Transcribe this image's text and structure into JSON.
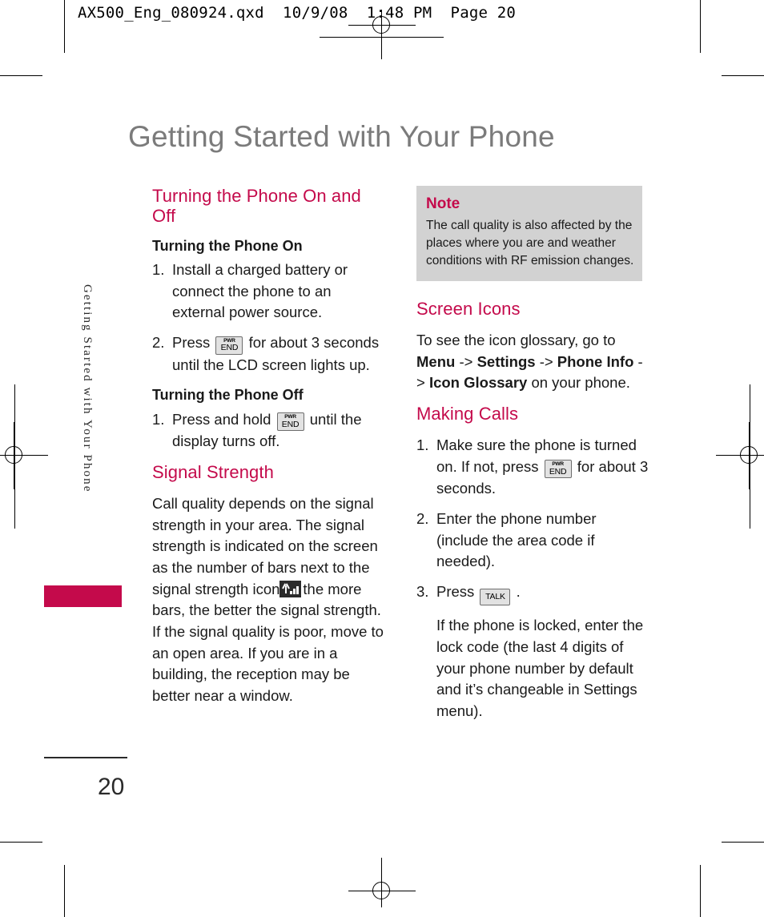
{
  "printer_slug": "AX500_Eng_080924.qxd  10/9/08  1:48 PM  Page 20",
  "page_title": "Getting Started with Your Phone",
  "side_tab": {
    "label": "Getting Started with Your Phone"
  },
  "page_number": "20",
  "left_column": {
    "section_heading": "Turning the Phone On and Off",
    "subheading_on": "Turning the Phone On",
    "on_steps": [
      {
        "num": "1.",
        "text": "Install a charged battery or connect the phone to an external power source."
      },
      {
        "num": "2.",
        "text_before": "Press",
        "key": "PWR END",
        "text_after": "for about 3 seconds until the LCD screen lights up."
      }
    ],
    "subheading_off": "Turning the Phone Off",
    "off_steps": [
      {
        "num": "1.",
        "text_before": "Press and hold",
        "key": "PWR END",
        "text_after": "until the display turns off."
      }
    ],
    "signal_heading": "Signal Strength",
    "signal_text_before": "Call quality depends on the signal strength in your area. The signal strength is indicated on the screen as the number of bars next to the signal strength icon",
    "signal_icon": "signal-strength-icon",
    "signal_text_after": "the more bars, the better the signal strength. If the signal quality is poor, move to an open area. If you are in a building, the reception may be better near a window."
  },
  "right_column": {
    "note": {
      "title": "Note",
      "text": "The call quality is also affected by the places where you are and weather conditions with RF emission changes."
    },
    "screen_icons_heading": "Screen Icons",
    "screen_icons_text_intro": "To see the icon glossary, go to",
    "screen_icons_path": [
      "Menu",
      "Settings",
      "Phone Info",
      "Icon Glossary"
    ],
    "screen_icons_arrow": "->",
    "screen_icons_text_outro": "on your phone.",
    "making_calls_heading": "Making Calls",
    "call_steps": [
      {
        "num": "1.",
        "text_before": "Make sure the phone is turned on. If not, press",
        "key": "PWR END",
        "text_after": "for about 3 seconds."
      },
      {
        "num": "2.",
        "text": "Enter the phone number (include the area code if needed)."
      },
      {
        "num": "3.",
        "text_before": "Press",
        "key": "TALK",
        "text_after": "."
      }
    ],
    "locked_note": "If the phone is locked, enter the lock code (the last 4 digits of your phone number by default and it’s changeable in Settings menu)."
  },
  "keys": {
    "pwr_line1": "PWR",
    "pwr_line2": "END",
    "talk": "TALK"
  },
  "colors": {
    "accent": "#c40a4b",
    "title_gray": "#7b7b7b",
    "note_background": "#d2d2d2",
    "body_text": "#1a1a1a"
  }
}
